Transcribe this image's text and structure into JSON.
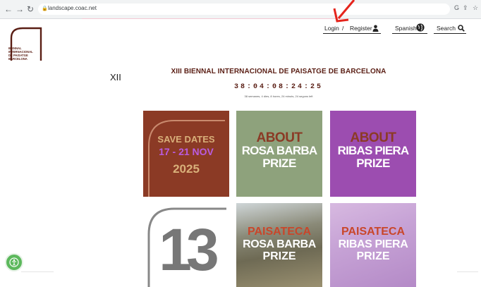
{
  "browser": {
    "url": "landscape.coac.net",
    "back_icon": "arrow-left-icon",
    "forward_icon": "arrow-right-icon",
    "reload_icon": "reload-icon"
  },
  "logo": {
    "lines": [
      "BIENNAL",
      "INTERNACIONAL",
      "DE PAISATGE",
      "BARCELONA"
    ]
  },
  "header": {
    "login": "Login",
    "separator": "/",
    "register": "Register",
    "language": "Spanish",
    "search": "Search"
  },
  "edition": "XII",
  "title": "XIII BIENNAL INTERNACIONAL DE PAISATGE DE BARCELONA",
  "countdown": "38:04:08:24:25",
  "countdown_sub": "38 semanes, 4 dies, 8 hores, 24 minuts, 24 segons left",
  "tiles": {
    "save_dates": {
      "line1": "SAVE DATES",
      "line2": "17 - 21 NOV",
      "line3": "2025"
    },
    "about_rosa": {
      "line1": "ABOUT",
      "line2": "ROSA BARBA",
      "line3": "PRIZE"
    },
    "about_ribas": {
      "line1": "ABOUT",
      "line2": "RIBAS PIERA",
      "line3": "PRIZE"
    },
    "thirteen": {
      "number": "13"
    },
    "paisateca_rosa": {
      "line1": "PAISATECA",
      "line2": "ROSA BARBA",
      "line3": "PRIZE"
    },
    "paisateca_ribas": {
      "line1": "PAISATECA",
      "line2": "RIBAS PIERA",
      "line3": "PRIZE"
    }
  },
  "colors": {
    "brand": "#5a1e14",
    "save_dates_bg": "#8b3a25",
    "rosa_bg": "#8ea27c",
    "ribas_bg": "#9c4db0",
    "title_accent": "#7a2a14"
  }
}
